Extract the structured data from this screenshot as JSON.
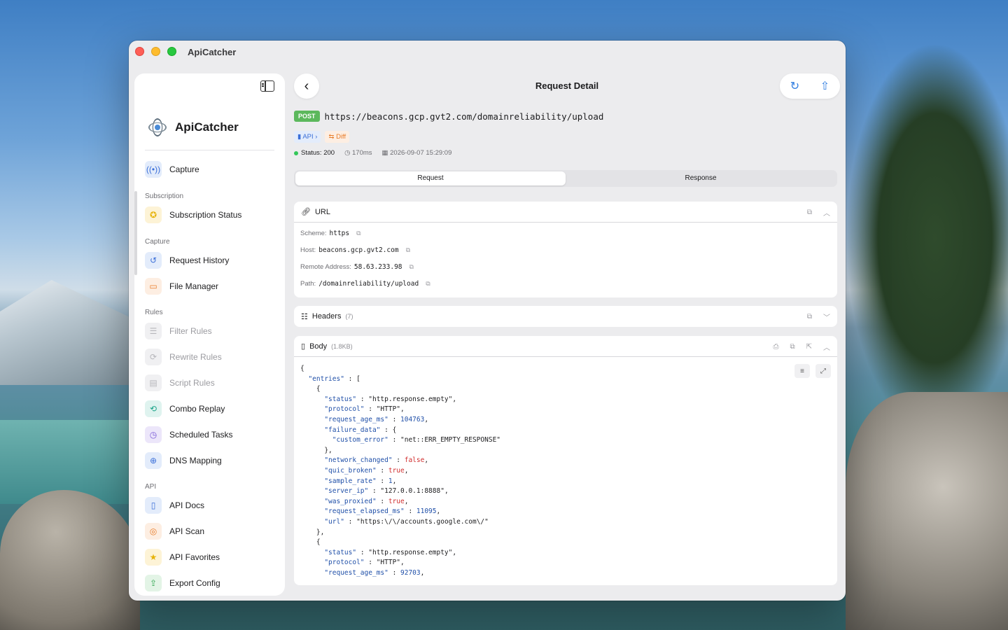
{
  "window": {
    "title": "ApiCatcher"
  },
  "sidebar": {
    "brand": "ApiCatcher",
    "capture_item": {
      "label": "Capture",
      "icon": "antenna-icon"
    },
    "sections": [
      {
        "title": "Subscription"
      },
      {
        "title": "Capture"
      },
      {
        "title": "Rules"
      },
      {
        "title": "API"
      }
    ],
    "items": [
      {
        "label": "Subscription Status",
        "icon": "star-badge-icon"
      },
      {
        "label": "Request History",
        "icon": "history-icon"
      },
      {
        "label": "File Manager",
        "icon": "folder-icon"
      },
      {
        "label": "Filter Rules",
        "icon": "filter-icon",
        "disabled": true
      },
      {
        "label": "Rewrite Rules",
        "icon": "rewrite-icon",
        "disabled": true
      },
      {
        "label": "Script Rules",
        "icon": "script-icon",
        "disabled": true
      },
      {
        "label": "Combo Replay",
        "icon": "replay-icon"
      },
      {
        "label": "Scheduled Tasks",
        "icon": "clock-icon"
      },
      {
        "label": "DNS Mapping",
        "icon": "globe-icon"
      },
      {
        "label": "API Docs",
        "icon": "doc-icon"
      },
      {
        "label": "API Scan",
        "icon": "scan-icon"
      },
      {
        "label": "API Favorites",
        "icon": "star-icon"
      },
      {
        "label": "Export Config",
        "icon": "export-icon"
      }
    ]
  },
  "header": {
    "title": "Request Detail"
  },
  "request": {
    "method": "POST",
    "url": "https://beacons.gcp.gvt2.com/domainreliability/upload",
    "tag_api": "API",
    "tag_diff": "Diff",
    "status": "Status: 200",
    "duration": "170ms",
    "timestamp": "2026-09-07 15:29:09"
  },
  "tabs": {
    "request": "Request",
    "response": "Response",
    "active": "Request"
  },
  "url_section": {
    "title": "URL",
    "scheme_label": "Scheme:",
    "scheme": "https",
    "host_label": "Host:",
    "host": "beacons.gcp.gvt2.com",
    "remote_label": "Remote Address:",
    "remote": "58.63.233.98",
    "path_label": "Path:",
    "path": "/domainreliability/upload"
  },
  "headers_section": {
    "title": "Headers",
    "count": "(7)"
  },
  "body_section": {
    "title": "Body",
    "size": "(1.8KB)"
  },
  "colors": {
    "accent": "#2f7de1",
    "post": "#5cb85c",
    "status_ok": "#34c759",
    "bool": "#d12f2f",
    "key": "#1f4fa8"
  }
}
